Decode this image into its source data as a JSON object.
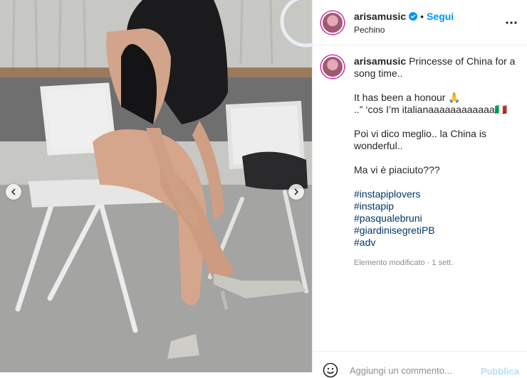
{
  "post": {
    "username": "arisamusic",
    "follow_label": "Segui",
    "location": "Pechino",
    "separator": "•",
    "caption": {
      "line1": "Princesse of China for a",
      "line2": "song time..",
      "line3": "It has been a honour 🙏",
      "line4": "..” ‘cos I’m italianaaaaaaaaaaaa🇮🇹",
      "line5": "Poi vi dico meglio.. la China is",
      "line6": "wonderful..",
      "line7": "Ma vi è piaciuto???"
    },
    "hashtags": [
      "#instapiplovers",
      "#instapip",
      "#pasqualebruni",
      "#giardinisegretiPB",
      "#adv"
    ],
    "meta": "Elemento modificato · 1 sett."
  },
  "comment": {
    "placeholder": "Aggiungi un commento...",
    "publish_label": "Pubblica"
  },
  "icons": {
    "verified": "verified-badge-icon",
    "more": "more-options-icon",
    "prev": "chevron-left-icon",
    "next": "chevron-right-icon",
    "emoji": "emoji-icon"
  },
  "colors": {
    "accent": "#0095f6",
    "hashtag": "#00376b",
    "muted": "#8e8e8e"
  }
}
